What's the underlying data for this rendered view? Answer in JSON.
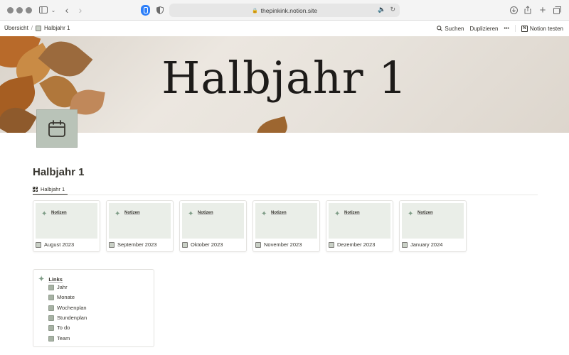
{
  "browser": {
    "url": "thepinkink.notion.site"
  },
  "topbar": {
    "breadcrumb_root": "Übersicht",
    "breadcrumb_separator": "/",
    "breadcrumb_page": "Halbjahr 1",
    "search_label": "Suchen",
    "duplicate_label": "Duplizieren",
    "more_label": "•••",
    "try_notion_label": "Notion testen"
  },
  "cover": {
    "title": "Halbjahr 1",
    "icon": "calendar-icon"
  },
  "page": {
    "title": "Halbjahr 1",
    "view_tab_label": "Halbjahr 1"
  },
  "cards": [
    {
      "preview_label": "Notizen",
      "title": "August 2023"
    },
    {
      "preview_label": "Notizen",
      "title": "September 2023"
    },
    {
      "preview_label": "Notizen",
      "title": "Oktober 2023"
    },
    {
      "preview_label": "Notizen",
      "title": "November 2023"
    },
    {
      "preview_label": "Notizen",
      "title": "Dezember 2023"
    },
    {
      "preview_label": "Notizen",
      "title": "January 2024"
    }
  ],
  "links": {
    "heading": "Links",
    "items": [
      "Jahr",
      "Monate",
      "Wochenplan",
      "Stundenplan",
      "To do",
      "Team"
    ]
  },
  "colors": {
    "accent_sage": "#b9c3b8",
    "sparkle_green": "#7e9c86",
    "browser_blue": "#2d7ff9"
  }
}
